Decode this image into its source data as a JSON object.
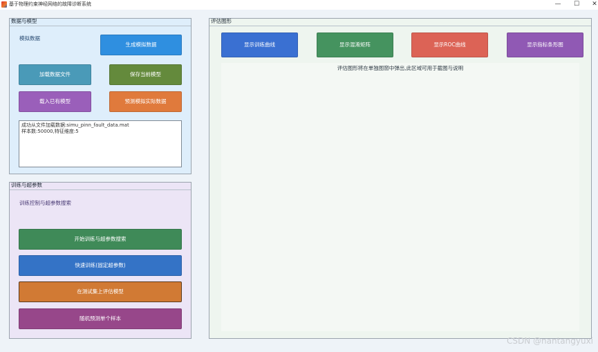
{
  "window": {
    "title": "基于物理约束神经网络的故障诊断系统",
    "minimize": "—",
    "maximize": "☐",
    "close": "✕"
  },
  "data_group": {
    "title": "数据与模型",
    "label": "模拟数据",
    "buttons": {
      "generate": "生成模拟数据",
      "load_file": "加载数据文件",
      "save_model": "保存当前模型",
      "load_model": "载入已有模型",
      "predict_real": "预测模拟实际数据"
    },
    "log_lines": [
      "成功从文件加载数据:simu_pinn_fault_data.mat",
      "样本数:50000,特征维度:5"
    ]
  },
  "train_group": {
    "title": "训练与超参数",
    "label": "训练控制与超参数搜索",
    "buttons": {
      "start_search": "开始训练与超参数搜索",
      "quick_train": "快速训练(固定超参数)",
      "evaluate": "在测试集上评估模型",
      "random_predict": "随机预测单个样本"
    }
  },
  "eval_group": {
    "title": "评估图形",
    "buttons": {
      "train_curve": "显示训练曲线",
      "confusion": "显示混淆矩阵",
      "roc": "显示ROC曲线",
      "metrics_bar": "显示指标条形图"
    },
    "note": "评估图形将在单独图窗中弹出,此区域可用于截图与说明"
  },
  "watermark": "CSDN @nantangyuxi",
  "colors": {
    "generate": "#2f8fe0",
    "load_file": "#4a9ab8",
    "save_model": "#648a3c",
    "load_model": "#9a5fba",
    "predict_real": "#e07a3c",
    "start_search": "#3f8a58",
    "quick_train": "#3473c6",
    "evaluate": "#d17a34",
    "random_predict": "#97478a",
    "train_curve": "#3a70d2",
    "confusion": "#45935f",
    "roc": "#dc6356",
    "metrics_bar": "#9059b4"
  }
}
